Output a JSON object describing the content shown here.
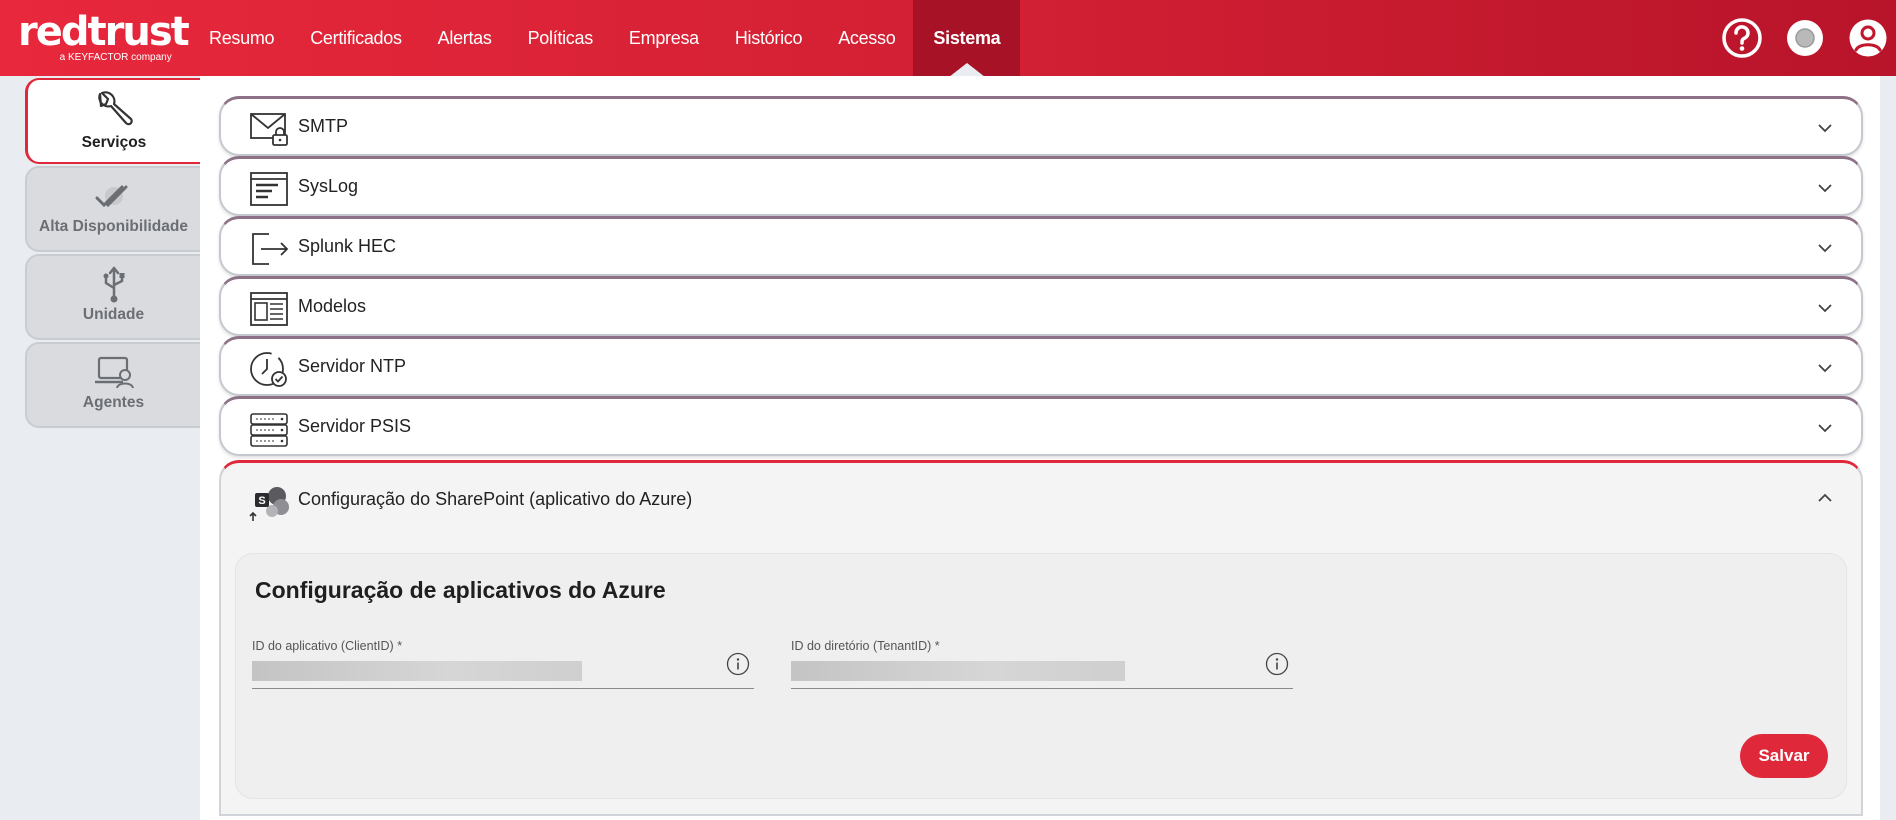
{
  "header": {
    "logo_text": "redtrust",
    "logo_subtext": "a KEYFACTOR company",
    "nav": [
      {
        "label": "Resumo"
      },
      {
        "label": "Certificados"
      },
      {
        "label": "Alertas"
      },
      {
        "label": "Políticas"
      },
      {
        "label": "Empresa"
      },
      {
        "label": "Histórico"
      },
      {
        "label": "Acesso"
      },
      {
        "label": "Sistema",
        "active": true
      }
    ],
    "icons": [
      "help-icon",
      "status-circle-icon",
      "user-account-icon"
    ]
  },
  "sidebar": {
    "items": [
      {
        "label": "Serviços",
        "icon": "wrench-icon",
        "active": true
      },
      {
        "label": "Alta Disponibilidade",
        "icon": "double-check-icon"
      },
      {
        "label": "Unidade",
        "icon": "usb-icon"
      },
      {
        "label": "Agentes",
        "icon": "agent-laptop-icon"
      }
    ]
  },
  "panels": [
    {
      "title": "SMTP",
      "icon": "mail-lock-icon"
    },
    {
      "title": "SysLog",
      "icon": "log-window-icon"
    },
    {
      "title": "Splunk HEC",
      "icon": "export-arrow-icon"
    },
    {
      "title": "Modelos",
      "icon": "template-icon"
    },
    {
      "title": "Servidor NTP",
      "icon": "clock-check-icon"
    },
    {
      "title": "Servidor PSIS",
      "icon": "server-stack-icon"
    }
  ],
  "open_panel": {
    "title": "Configuração do SharePoint (aplicativo do Azure)",
    "icon": "sharepoint-icon",
    "card_title": "Configuração de aplicativos do Azure",
    "fields": [
      {
        "label": "ID do aplicativo (ClientID) *",
        "value_redacted": true
      },
      {
        "label": "ID do diretório (TenantID) *",
        "value_redacted": true
      }
    ],
    "save_label": "Salvar"
  },
  "colors": {
    "brand_red": "#e0283b",
    "header_dark": "#a81226"
  }
}
